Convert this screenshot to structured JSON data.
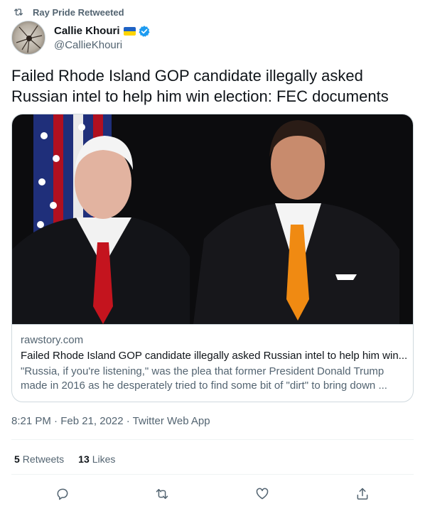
{
  "retweet_banner": {
    "text": "Ray Pride Retweeted"
  },
  "author": {
    "name": "Callie Khouri",
    "handle": "@CallieKhouri"
  },
  "tweet": {
    "text": "Failed Rhode Island GOP candidate illegally asked Russian intel to help him win election: FEC documents"
  },
  "card": {
    "domain": "rawstory.com",
    "title": "Failed Rhode Island GOP candidate illegally asked Russian intel to help him win...",
    "description": "\"Russia, if you're listening,\" was the plea that former President Donald Trump made in 2016 as he desperately tried to find some bit of \"dirt\" to bring down ..."
  },
  "meta": {
    "timestamp": "8:21 PM · Feb 21, 2022 · Twitter Web App"
  },
  "stats": {
    "retweets_count": "5",
    "retweets_label": "Retweets",
    "likes_count": "13",
    "likes_label": "Likes"
  },
  "colors": {
    "secondary_text": "#536471",
    "primary_text": "#0f1419",
    "border": "#cfd9de",
    "verified": "#1d9bf0"
  }
}
